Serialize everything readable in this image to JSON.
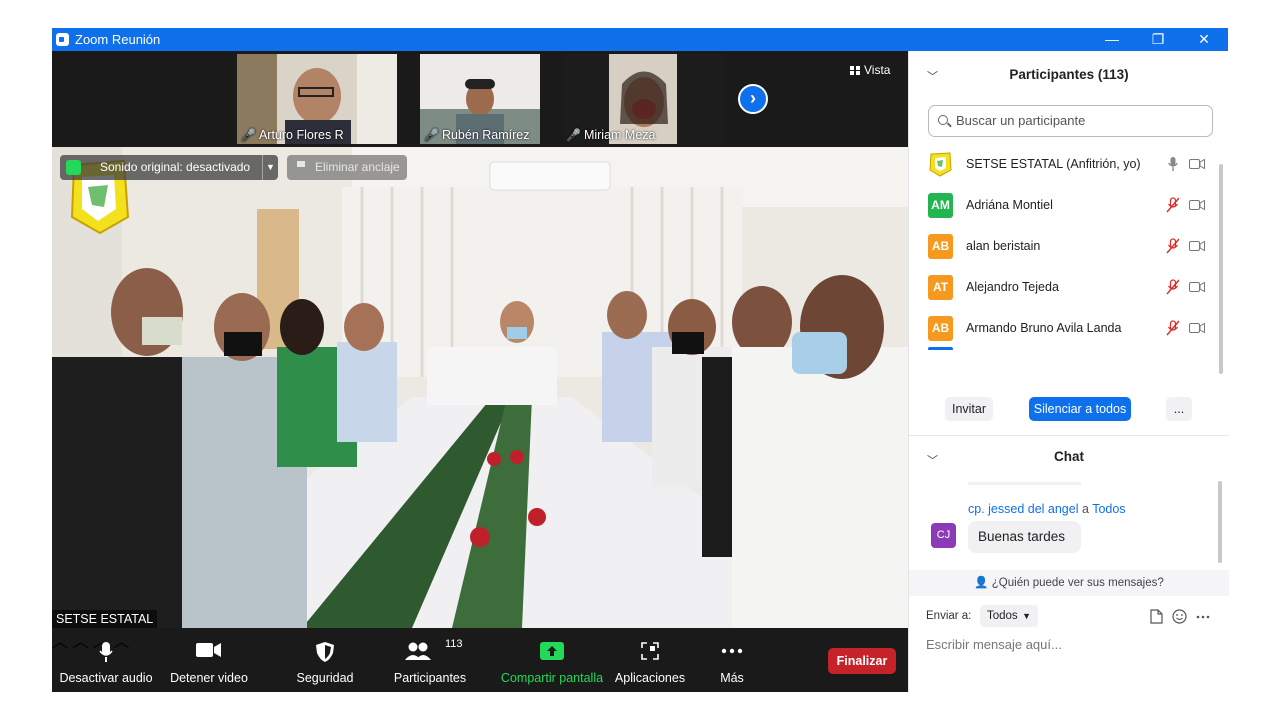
{
  "window": {
    "title": "Zoom Reunión",
    "controls": {
      "minimize": "—",
      "restore": "❐",
      "close": "✕"
    }
  },
  "thumbnails": [
    {
      "name": "Arturo Flores R"
    },
    {
      "name": "Rubén Ramírez"
    },
    {
      "name": "Miriam Meza"
    }
  ],
  "view_label": "Vista",
  "main_video": {
    "original_sound": "Sonido original: desactivado",
    "unpin": "Eliminar anclaje",
    "speaker_name": "SETSE ESTATAL"
  },
  "toolbar": {
    "mute": "Desactivar audio",
    "stop_video": "Detener video",
    "security": "Seguridad",
    "participants": "Participantes",
    "participants_count": "113",
    "share": "Compartir pantalla",
    "apps": "Aplicaciones",
    "more": "Más",
    "end": "Finalizar"
  },
  "participants_panel": {
    "title": "Participantes (113)",
    "search_placeholder": "Buscar un participante",
    "list": [
      {
        "initials": "",
        "name": "SETSE ESTATAL (Anfitrión, yo)",
        "color": "#ffffff",
        "muted": false
      },
      {
        "initials": "AM",
        "name": "Adriána Montiel",
        "color": "#23b550",
        "muted": true
      },
      {
        "initials": "AB",
        "name": "alan beristain",
        "color": "#f59a1e",
        "muted": true
      },
      {
        "initials": "AT",
        "name": "Alejandro Tejeda",
        "color": "#f59a1e",
        "muted": true
      },
      {
        "initials": "AB",
        "name": "Armando Bruno Avila Landa",
        "color": "#f59a1e",
        "muted": true
      }
    ],
    "invite": "Invitar",
    "mute_all": "Silenciar a todos",
    "more": "..."
  },
  "chat": {
    "title": "Chat",
    "sender": "cp. jessed  del angel",
    "to_word": "a",
    "recipient": "Todos",
    "avatar": "CJ",
    "message": "Buenas tardes",
    "who_can_see": "¿Quién puede ver sus mensajes?",
    "send_to_label": "Enviar a:",
    "send_to_value": "Todos",
    "input_placeholder": "Escribir mensaje aquí..."
  },
  "colors": {
    "titlebar": "#0e71eb",
    "accent": "#0e71eb",
    "end_button": "#c5222a",
    "share_green": "#23d959",
    "muted_red": "#e02828"
  }
}
